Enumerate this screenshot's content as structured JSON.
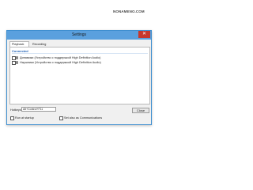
{
  "watermark": "NONAMENO.COM",
  "window": {
    "title": "Settings",
    "close_glyph": "✕"
  },
  "tabs": [
    {
      "label": "Playback",
      "active": true
    },
    {
      "label": "Recording",
      "active": false
    }
  ],
  "panel": {
    "group_header": "Connected",
    "devices": [
      {
        "label": "Динамики (Устройство с поддержкой High Definition Audio)",
        "checked": false
      },
      {
        "label": "Наушники (Устройство с поддержкой High Definition Audio)",
        "checked": false
      }
    ]
  },
  "hotkey": {
    "label": "Hotkeys",
    "value": "Alt+Control+F11"
  },
  "buttons": {
    "close_label": "Close"
  },
  "options": {
    "run_at_startup": "Run at startup",
    "set_communications": "Set also as Communications"
  },
  "colors": {
    "titlebar": "#5aa0de",
    "close_button": "#c7372c",
    "group_header": "#1d5fb4"
  },
  "icons": {
    "device_icon": "speaker-icon",
    "close_icon": "close-icon"
  }
}
